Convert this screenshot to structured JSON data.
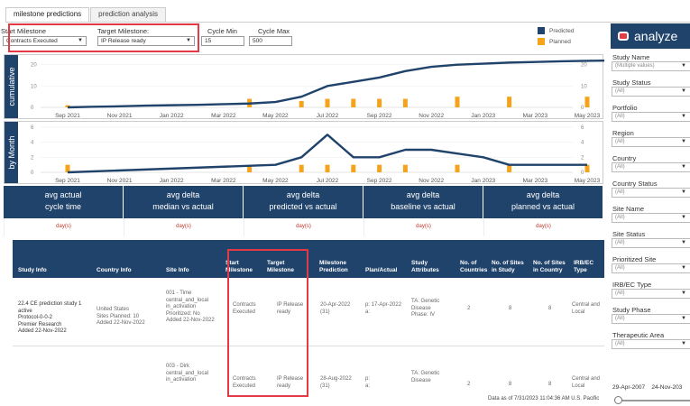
{
  "tabs": [
    {
      "label": "milestone predictions",
      "active": true
    },
    {
      "label": "prediction analysis",
      "active": false
    }
  ],
  "filters": {
    "start_label": "Start Milestone",
    "start_value": "Contracts Executed",
    "target_label": "Target Milestone:",
    "target_value": "IP Release ready",
    "cycle_min_label": "Cycle Min",
    "cycle_min_value": "15",
    "cycle_max_label": "Cycle Max",
    "cycle_max_value": "500"
  },
  "legend": [
    {
      "label": "Predicted",
      "color": "#20436b"
    },
    {
      "label": "Planned",
      "color": "#f5a31a"
    }
  ],
  "charts": {
    "cumulative_label": "cumulative",
    "monthly_label": "by Month",
    "x_ticks": [
      "Sep 2021",
      "Nov 2021",
      "Jan 2022",
      "Mar 2022",
      "May 2022",
      "Jul 2022",
      "Sep 2022",
      "Nov 2022",
      "Jan 2023",
      "Mar 2023",
      "May 2023"
    ]
  },
  "chart_data": [
    {
      "type": "line",
      "title": "cumulative",
      "x_ticks": [
        "Sep 2021",
        "Nov 2021",
        "Jan 2022",
        "Mar 2022",
        "May 2022",
        "Jul 2022",
        "Sep 2022",
        "Nov 2022",
        "Jan 2023",
        "Mar 2023",
        "May 2023"
      ],
      "ylim": [
        0,
        22
      ],
      "y_ticks": [
        0,
        10,
        20
      ],
      "series": [
        {
          "name": "Predicted",
          "type": "line",
          "x": [
            "Sep 2021",
            "Oct 2021",
            "Nov 2021",
            "Dec 2021",
            "Jan 2022",
            "Feb 2022",
            "Mar 2022",
            "Apr 2022",
            "May 2022",
            "Jun 2022",
            "Jul 2022",
            "Aug 2022",
            "Sep 2022",
            "Oct 2022",
            "Nov 2022",
            "Dec 2022",
            "Jan 2023",
            "Feb 2023",
            "Mar 2023",
            "Apr 2023",
            "May 2023",
            "Jun 2023"
          ],
          "values": [
            0,
            0.3,
            0.5,
            0.8,
            1,
            1.2,
            1.5,
            1.8,
            2.5,
            5,
            10,
            12,
            14,
            17,
            19,
            20,
            20.5,
            21,
            21.3,
            21.6,
            21.8,
            22
          ]
        },
        {
          "name": "Planned",
          "type": "bar",
          "x": [
            "Sep 2021",
            "Apr 2022",
            "Jun 2022",
            "Jul 2022",
            "Aug 2022",
            "Sep 2022",
            "Oct 2022",
            "Dec 2022",
            "Feb 2023",
            "May 2023"
          ],
          "values": [
            1,
            4,
            3,
            4,
            4,
            4,
            4,
            5,
            5,
            5
          ]
        }
      ]
    },
    {
      "type": "line",
      "title": "by Month",
      "x_ticks": [
        "Sep 2021",
        "Nov 2021",
        "Jan 2022",
        "Mar 2022",
        "May 2022",
        "Jul 2022",
        "Sep 2022",
        "Nov 2022",
        "Jan 2023",
        "Mar 2023",
        "May 2023"
      ],
      "ylim": [
        0,
        6
      ],
      "y_ticks": [
        0,
        2,
        4,
        6
      ],
      "series": [
        {
          "name": "Predicted",
          "type": "line",
          "x": [
            "Sep 2021",
            "May 2022",
            "Jun 2022",
            "Jul 2022",
            "Aug 2022",
            "Sep 2022",
            "Oct 2022",
            "Nov 2022",
            "Dec 2022",
            "Jan 2023",
            "Feb 2023",
            "Mar 2023",
            "Apr 2023",
            "May 2023"
          ],
          "values": [
            0,
            1,
            2,
            5,
            2,
            2,
            3,
            3,
            2.5,
            2,
            1,
            1,
            1,
            1
          ]
        },
        {
          "name": "Planned",
          "type": "bar",
          "x": [
            "Sep 2021",
            "Apr 2022",
            "Jun 2022",
            "Jul 2022",
            "Aug 2022",
            "Sep 2022",
            "Oct 2022",
            "Dec 2022",
            "Feb 2023",
            "May 2023"
          ],
          "values": [
            1,
            1,
            1,
            1,
            1,
            1,
            1,
            1,
            1,
            1
          ]
        }
      ]
    }
  ],
  "kpis": [
    {
      "title": "avg actual\ncycle time",
      "value": "day(s)"
    },
    {
      "title": "avg delta\nmedian vs actual",
      "value": "day(s)"
    },
    {
      "title": "avg delta\npredicted vs actual",
      "value": "day(s)"
    },
    {
      "title": "avg delta\nbaseline vs actual",
      "value": "day(s)"
    },
    {
      "title": "avg delta\nplanned vs actual",
      "value": "day(s)"
    }
  ],
  "table": {
    "headers": [
      "Study Info",
      "Country Info",
      "Site Info",
      "Start\nMilestone",
      "Target\nMilestone",
      "Milestone\nPrediction",
      "Plan/Actual",
      "Study\nAttributes",
      "No. of\nCountries",
      "No. of Sites\nin Study",
      "No. of Sites\nin Country",
      "IRB/EC Type"
    ],
    "rows": [
      {
        "study": "22.4 CE prediction study 1\nactive\nProtocol-0-0-2\nPremier Research\nAdded 22-Nov-2022",
        "country": "United States\nSites Planned: 10\nAdded 22-Nov-2022",
        "site": "001 - Time\ncentral_and_local\nin_activation\nPrioritized: No\nAdded 22-Nov-2022",
        "start": "Contracts\nExecuted",
        "target": "IP Release\nready",
        "prediction": "20-Apr-2022\n(31)",
        "plan": "p: 17-Apr-2022\na:",
        "attributes": "TA: Genetic\nDisease\nPhase: IV",
        "countries": "2",
        "sites_study": "8",
        "sites_country": "8",
        "irb": "Central and\nLocal"
      },
      {
        "study": "",
        "country": "",
        "site": "003 - Dirk\ncentral_and_local\nin_activation",
        "start": "Contracts\nExecuted",
        "target": "IP Release\nready",
        "prediction": "28-Aug-2022\n(31)",
        "plan": "p:\na:",
        "attributes": "TA: Genetic\nDisease",
        "countries": "2",
        "sites_study": "8",
        "sites_country": "8",
        "irb": "Central and\nLocal"
      }
    ]
  },
  "footer": "Data as of 7/31/2023 11:04:36 AM U.S. Pacific",
  "sidebar": {
    "brand": "analyze",
    "filters": [
      {
        "label": "Study Name",
        "value": "(Multiple values)"
      },
      {
        "label": "Study Status",
        "value": "(All)"
      },
      {
        "label": "Portfolio",
        "value": "(All)"
      },
      {
        "label": "Region",
        "value": "(All)"
      },
      {
        "label": "Country",
        "value": "(All)"
      },
      {
        "label": "Country Status",
        "value": "(All)"
      },
      {
        "label": "Site Name",
        "value": "(All)"
      },
      {
        "label": "Site Status",
        "value": "(All)"
      },
      {
        "label": "Prioritized Site",
        "value": "(All)"
      },
      {
        "label": "IRB/EC Type",
        "value": "(All)"
      },
      {
        "label": "Study Phase",
        "value": "(All)"
      },
      {
        "label": "Therapeutic Area",
        "value": "(All)"
      }
    ],
    "date_start": "29-Apr-2007",
    "date_end": "24-Nov-203"
  },
  "colors": {
    "navy": "#20436b",
    "orange": "#f5a31a",
    "highlight": "#e63946"
  }
}
